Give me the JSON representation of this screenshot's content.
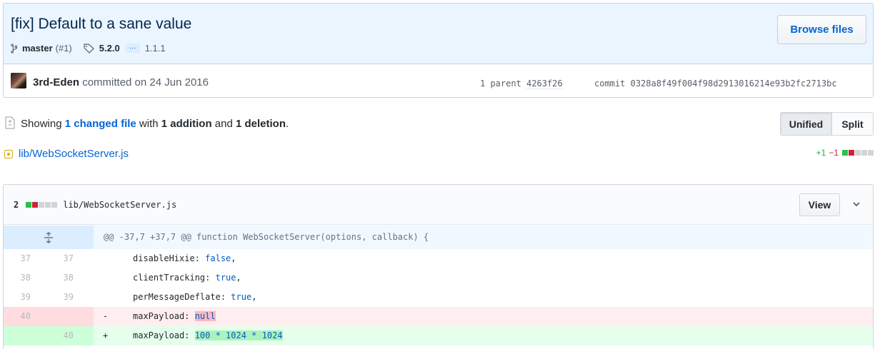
{
  "commit": {
    "title": "[fix] Default to a sane value",
    "branch": "master",
    "pr": "(#1)",
    "tag": "5.2.0",
    "ellipsis": "…",
    "tag_old": "1.1.1",
    "browse_label": "Browse files",
    "author": "3rd-Eden",
    "committed_text": "committed on 24 Jun 2016",
    "parent_label": "1 parent",
    "parent_sha": "4263f26",
    "commit_label": "commit",
    "commit_sha": "0328a8f49f004f98d2913016214e93b2fc2713bc"
  },
  "summary": {
    "showing": "Showing",
    "changed_files": "1 changed file",
    "with": "with",
    "additions": "1 addition",
    "and": "and",
    "deletions": "1 deletion",
    "period": "."
  },
  "view_toggle": {
    "unified": "Unified",
    "split": "Split"
  },
  "toc": {
    "file": "lib/WebSocketServer.js",
    "plus": "+1",
    "minus": "−1"
  },
  "file": {
    "count": "2",
    "path": "lib/WebSocketServer.js",
    "view_label": "View",
    "hunk_header": "@@ -37,7 +37,7 @@ function WebSocketServer(options, callback) {",
    "lines": [
      {
        "type": "ctx",
        "old": "37",
        "new": "37",
        "sign": "",
        "key": "disableHixie: ",
        "val": "false",
        "tail": ","
      },
      {
        "type": "ctx",
        "old": "38",
        "new": "38",
        "sign": "",
        "key": "clientTracking: ",
        "val": "true",
        "tail": ","
      },
      {
        "type": "ctx",
        "old": "39",
        "new": "39",
        "sign": "",
        "key": "perMessageDeflate: ",
        "val": "true",
        "tail": ","
      },
      {
        "type": "del",
        "old": "40",
        "new": "",
        "sign": "-",
        "key": "maxPayload: ",
        "val": "null",
        "tail": ""
      },
      {
        "type": "add",
        "old": "",
        "new": "40",
        "sign": "+",
        "key": "maxPayload: ",
        "val": "100 * 1024 * 1024",
        "tail": ""
      }
    ]
  },
  "colors": {
    "header_bg": "#eaf5ff",
    "link": "#0366d6",
    "addition": "#28a745",
    "deletion": "#cb2431"
  }
}
